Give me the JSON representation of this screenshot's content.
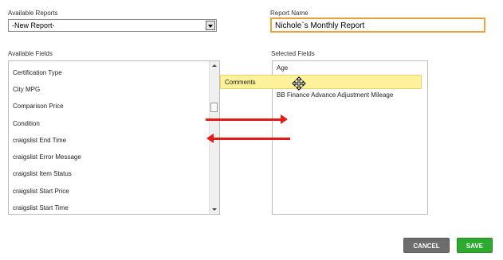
{
  "labels": {
    "available_reports": "Available Reports",
    "report_name": "Report Name",
    "available_fields": "Available Fields",
    "selected_fields": "Selected Fields"
  },
  "report_select": {
    "value": "-New Report-"
  },
  "report_name_value": "Nichole`s Monthly Report",
  "available_fields": [
    "Certification Type",
    "City MPG",
    "Comparison Price",
    "Condition",
    "craigslist End Time",
    "craigslist Error Message",
    "craigslist Item Status",
    "craigslist Start Price",
    "craigslist Start Time"
  ],
  "selected_fields": [
    "Age",
    "BB Finance Advance Adjustment Mileage"
  ],
  "dragging_item": "Comments",
  "buttons": {
    "cancel": "CANCEL",
    "save": "SAVE"
  },
  "colors": {
    "name_focus_border": "#e8a33c",
    "drag_highlight": "#fdf19b",
    "arrow": "#e41b17",
    "cancel_bg": "#6d6d6d",
    "save_bg": "#2eaa2e"
  },
  "icons": {
    "drag_cursor": "move-icon"
  }
}
